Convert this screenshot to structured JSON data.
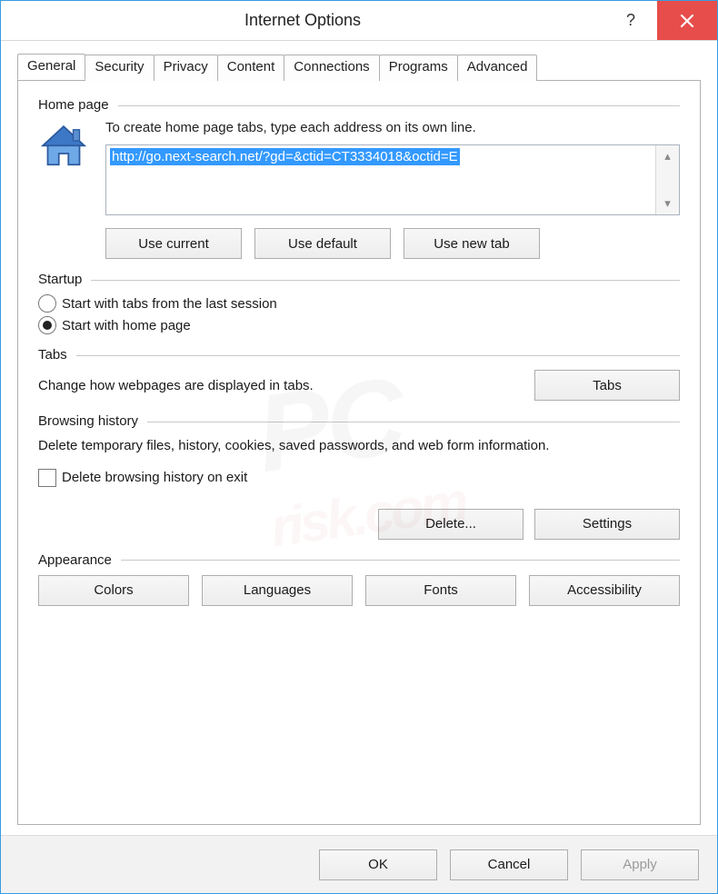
{
  "window": {
    "title": "Internet Options"
  },
  "tabs": {
    "items": [
      {
        "label": "General"
      },
      {
        "label": "Security"
      },
      {
        "label": "Privacy"
      },
      {
        "label": "Content"
      },
      {
        "label": "Connections"
      },
      {
        "label": "Programs"
      },
      {
        "label": "Advanced"
      }
    ],
    "activeIndex": 0
  },
  "homepage": {
    "group_label": "Home page",
    "description": "To create home page tabs, type each address on its own line.",
    "url_value": "http://go.next-search.net/?gd=&ctid=CT3334018&octid=E",
    "btn_use_current": "Use current",
    "btn_use_default": "Use default",
    "btn_use_new_tab": "Use new tab"
  },
  "startup": {
    "group_label": "Startup",
    "option_last_session": "Start with tabs from the last session",
    "option_home_page": "Start with home page",
    "selected": "home_page"
  },
  "tabs_section": {
    "group_label": "Tabs",
    "description": "Change how webpages are displayed in tabs.",
    "btn_tabs": "Tabs"
  },
  "browsing_history": {
    "group_label": "Browsing history",
    "description": "Delete temporary files, history, cookies, saved passwords, and web form information.",
    "checkbox_label": "Delete browsing history on exit",
    "checkbox_checked": false,
    "btn_delete": "Delete...",
    "btn_settings": "Settings"
  },
  "appearance": {
    "group_label": "Appearance",
    "btn_colors": "Colors",
    "btn_languages": "Languages",
    "btn_fonts": "Fonts",
    "btn_accessibility": "Accessibility"
  },
  "footer": {
    "btn_ok": "OK",
    "btn_cancel": "Cancel",
    "btn_apply": "Apply"
  },
  "watermark": {
    "line1": "PC",
    "line2": "risk.com"
  }
}
